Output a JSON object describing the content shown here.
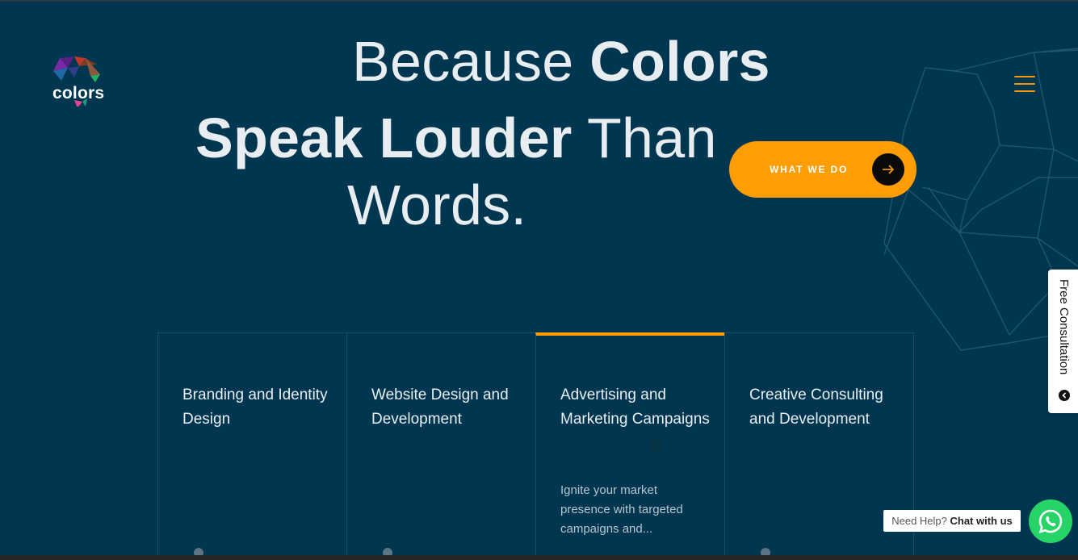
{
  "brand": {
    "logo_text": "colors"
  },
  "hero": {
    "line1_light": "Because ",
    "line1_bold": "Colors",
    "line2_bold": "Speak Louder",
    "line2_light": " Than",
    "line3_light": "Words."
  },
  "cta": {
    "label": "WHAT WE DO",
    "icon": "arrow-right-icon"
  },
  "menu": {
    "icon": "hamburger-icon"
  },
  "services": [
    {
      "title": "Branding and Identity Design",
      "description": ""
    },
    {
      "title": "Website Design and Development",
      "description": ""
    },
    {
      "title": "Advertising and Marketing Campaigns",
      "description": "Ignite your market presence with targeted campaigns and..."
    },
    {
      "title": "Creative Consulting and Development",
      "description": ""
    }
  ],
  "consultation": {
    "label": "Free Consultation",
    "icon": "chevron-left-icon"
  },
  "whatsapp": {
    "help_text": "Need Help?",
    "chat_text": "Chat with us",
    "icon": "whatsapp-icon"
  },
  "colors": {
    "background": "#003650",
    "accent": "#ff9e04",
    "whatsapp": "#25d366"
  }
}
